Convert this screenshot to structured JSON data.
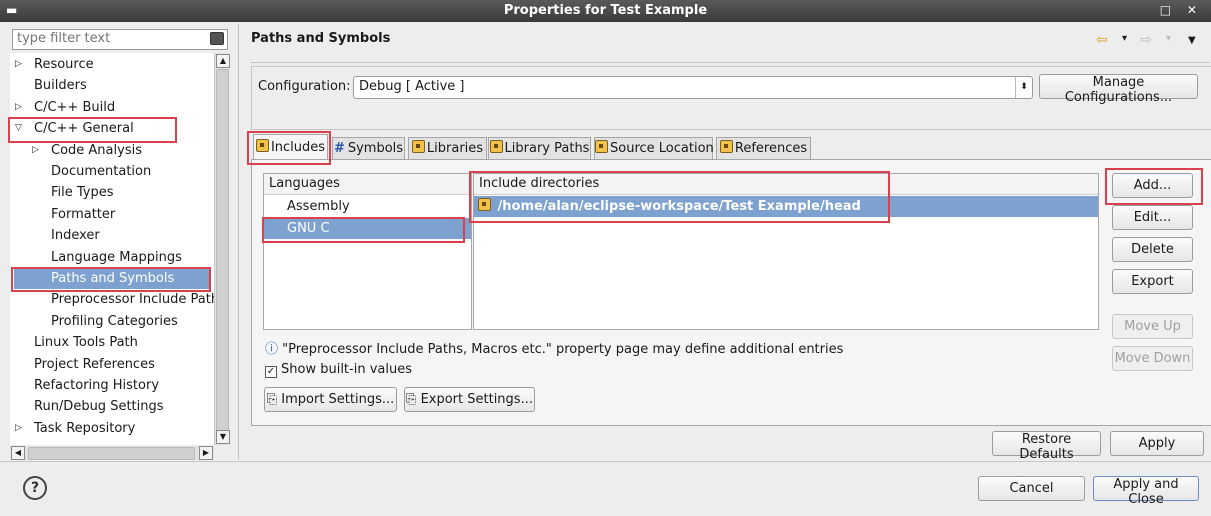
{
  "window": {
    "title": "Properties for Test Example",
    "menu_glyph": "▬",
    "controls": "□ ✕"
  },
  "filter": {
    "placeholder": "type filter text"
  },
  "tree": {
    "items": [
      {
        "label": "Resource",
        "arrow": "▷"
      },
      {
        "label": "Builders"
      },
      {
        "label": "C/C++ Build",
        "arrow": "▷"
      },
      {
        "label": "C/C++ General",
        "arrow": "▽"
      },
      {
        "label": "Code Analysis",
        "arrow": "▷"
      },
      {
        "label": "Documentation"
      },
      {
        "label": "File Types"
      },
      {
        "label": "Formatter"
      },
      {
        "label": "Indexer"
      },
      {
        "label": "Language Mappings"
      },
      {
        "label": "Paths and Symbols",
        "selected": true
      },
      {
        "label": "Preprocessor Include Paths"
      },
      {
        "label": "Profiling Categories"
      },
      {
        "label": "Linux Tools Path"
      },
      {
        "label": "Project References"
      },
      {
        "label": "Refactoring History"
      },
      {
        "label": "Run/Debug Settings"
      },
      {
        "label": "Task Repository",
        "arrow": "▷"
      }
    ]
  },
  "panel": {
    "title": "Paths and Symbols",
    "nav": {
      "back": "⇦",
      "down": "▾",
      "forward": "⇨",
      "menu": "▼"
    },
    "configuration_label": "Configuration:",
    "configuration_value": "Debug  [ Active ]",
    "manage_button": "Manage Configurations..."
  },
  "tabs": [
    {
      "label": "Includes",
      "icon": "includes-icon",
      "active": true
    },
    {
      "label": "Symbols",
      "icon": "hash-icon",
      "glyph": "#"
    },
    {
      "label": "Libraries",
      "icon": "libraries-icon"
    },
    {
      "label": "Library Paths",
      "icon": "library-paths-icon"
    },
    {
      "label": "Source Location",
      "icon": "source-folder-icon"
    },
    {
      "label": "References",
      "icon": "references-icon"
    }
  ],
  "languages": {
    "header": "Languages",
    "items": [
      "Assembly",
      "GNU C"
    ],
    "selected": "GNU C"
  },
  "includes": {
    "header": "Include directories",
    "items": [
      "/home/alan/eclipse-workspace/Test Example/head"
    ]
  },
  "side_buttons": {
    "add": "Add...",
    "edit": "Edit...",
    "delete": "Delete",
    "export": "Export",
    "move_up": "Move Up",
    "move_down": "Move Down"
  },
  "info_glyph": "ⓘ",
  "info_text": "\"Preprocessor Include Paths, Macros etc.\" property page may define additional entries",
  "show_builtin": {
    "label": "Show built-in values",
    "checked": true,
    "glyph": "✓"
  },
  "import_button": "Import Settings...",
  "export_settings_button": "Export Settings...",
  "restore_defaults": "Restore Defaults",
  "apply": "Apply",
  "cancel": "Cancel",
  "apply_close": "Apply and Close",
  "help_glyph": "?",
  "colors": {
    "selection": "#7ea2cf",
    "highlight": "#d9414f",
    "titlebar": "#3a3a3a"
  }
}
